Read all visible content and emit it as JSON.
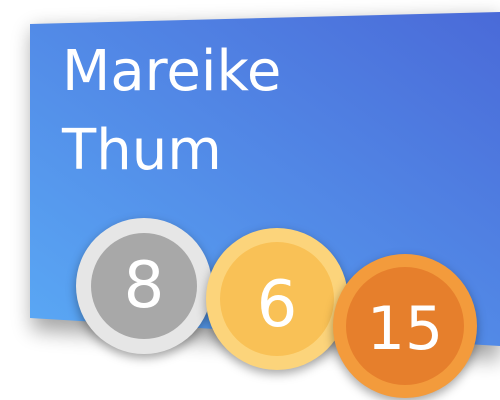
{
  "card": {
    "first_name": "Mareike",
    "last_name": "Thum",
    "gradient_start": "#5aa9f5",
    "gradient_end": "#4a6ad8"
  },
  "medals": {
    "silver": {
      "count": "8",
      "color": "#a8a8a8"
    },
    "gold": {
      "count": "6",
      "color": "#f9c156"
    },
    "bronze": {
      "count": "15",
      "color": "#e67f2c"
    }
  }
}
